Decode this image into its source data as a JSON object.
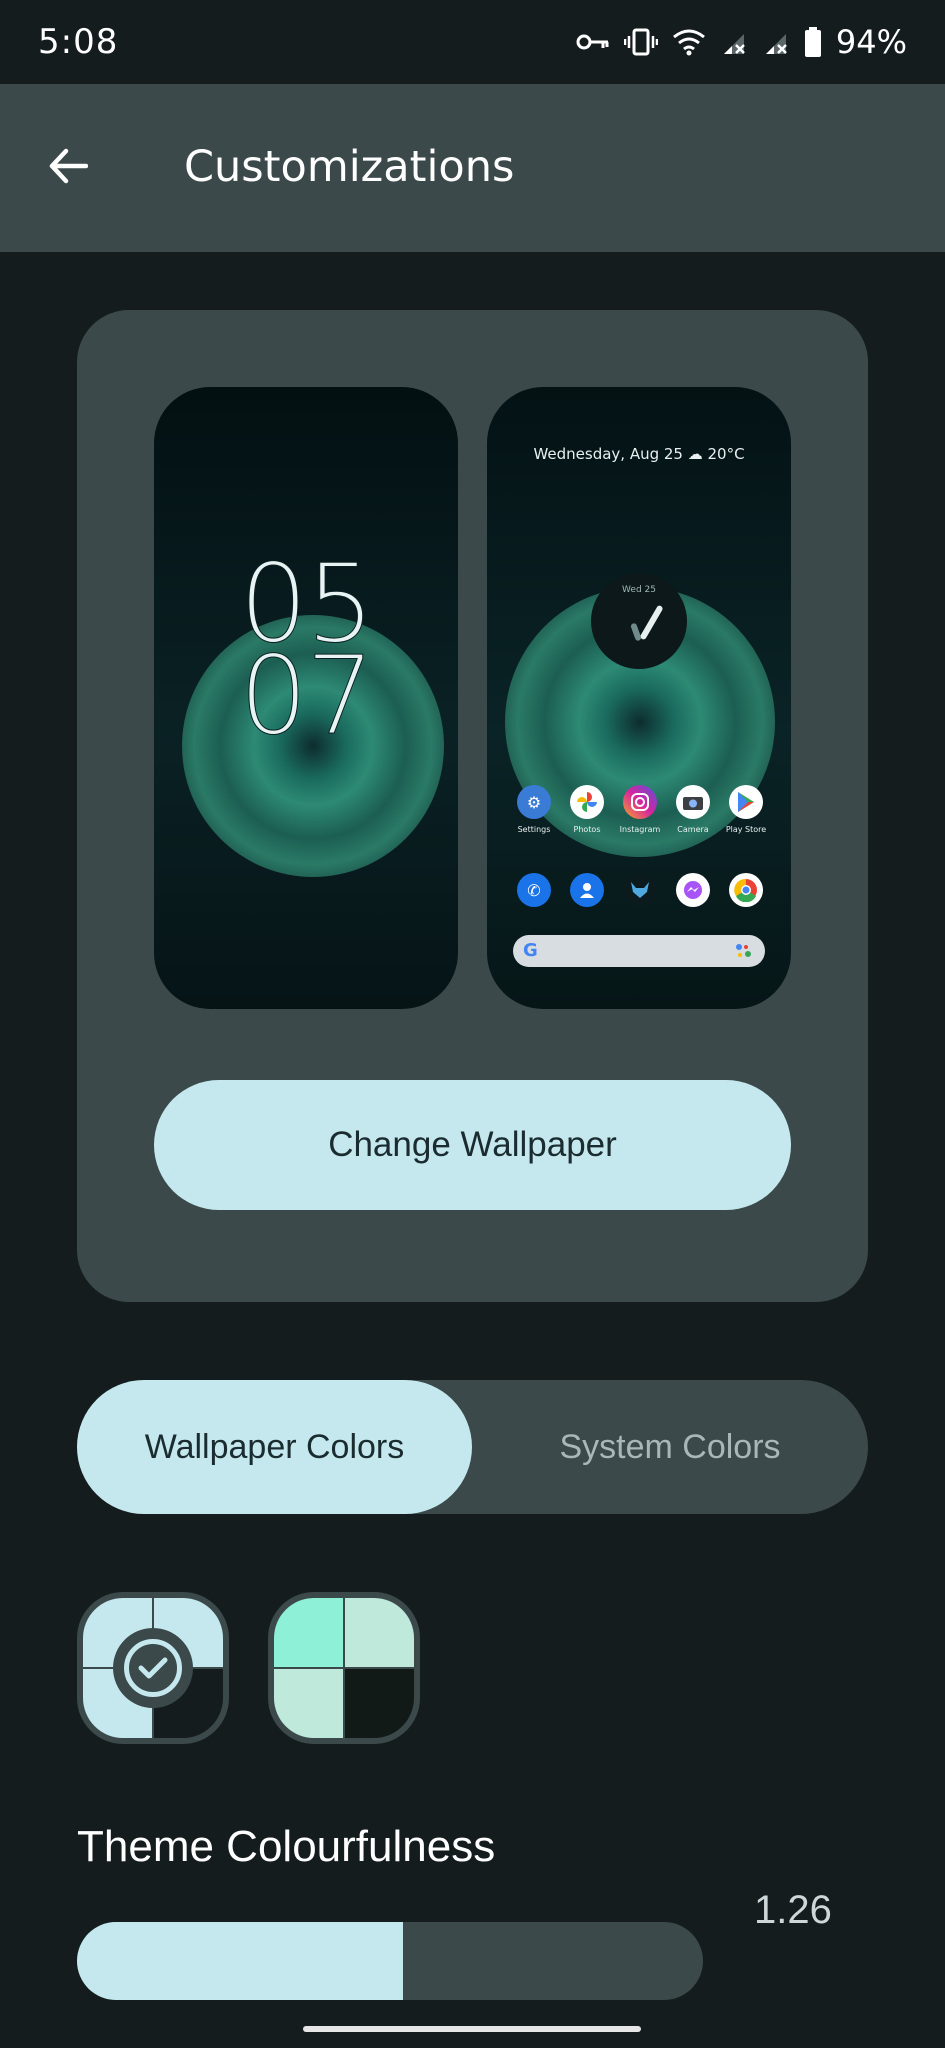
{
  "status_bar": {
    "time": "5:08",
    "battery": "94%",
    "icons": [
      "vpn-key-icon",
      "vibrate-icon",
      "wifi-icon",
      "signal-no-data-icon",
      "signal-no-data-icon",
      "battery-icon"
    ]
  },
  "app_bar": {
    "back_icon": "arrow-back-icon",
    "title": "Customizations"
  },
  "preview": {
    "lock_screen": {
      "clock_hours": "05",
      "clock_minutes": "07"
    },
    "home_screen": {
      "date_weather": "Wednesday, Aug 25  ☁ 20°C",
      "clock_widget_day": "Wed 25",
      "apps_row1": [
        {
          "label": "Settings",
          "icon": "settings-icon",
          "color": "#3a7bd5"
        },
        {
          "label": "Photos",
          "icon": "photos-icon",
          "color": "#ffffff"
        },
        {
          "label": "Instagram",
          "icon": "instagram-icon",
          "color": "#d6249f"
        },
        {
          "label": "Camera",
          "icon": "camera-icon",
          "color": "#ffffff"
        },
        {
          "label": "Play Store",
          "icon": "play-store-icon",
          "color": "#ffffff"
        }
      ],
      "apps_row2": [
        {
          "icon": "phone-icon",
          "color": "#1a73e8"
        },
        {
          "icon": "contacts-icon",
          "color": "#1a73e8"
        },
        {
          "icon": "fox-app-icon",
          "color": "#0b1a1c"
        },
        {
          "icon": "messenger-icon",
          "color": "#ffffff"
        },
        {
          "icon": "chrome-icon",
          "color": "#ffffff"
        }
      ],
      "search_logo": "G"
    },
    "change_wallpaper_label": "Change Wallpaper"
  },
  "color_source": {
    "options": [
      "Wallpaper Colors",
      "System Colors"
    ],
    "selected": "Wallpaper Colors"
  },
  "swatches": [
    {
      "selected": true,
      "colors": [
        "#c5e8ee",
        "#c5e8ee",
        "#c5e8ee",
        "#141c1e"
      ]
    },
    {
      "selected": false,
      "colors": [
        "#8ff0d8",
        "#bfeadb",
        "#bfeadb",
        "#121a18"
      ]
    }
  ],
  "theme_colourfulness": {
    "title": "Theme Colourfulness",
    "value": "1.26",
    "fill_fraction": 0.52
  },
  "colors": {
    "accent": "#c5e8ee",
    "surface": "#3b494b",
    "background": "#141c1e"
  }
}
